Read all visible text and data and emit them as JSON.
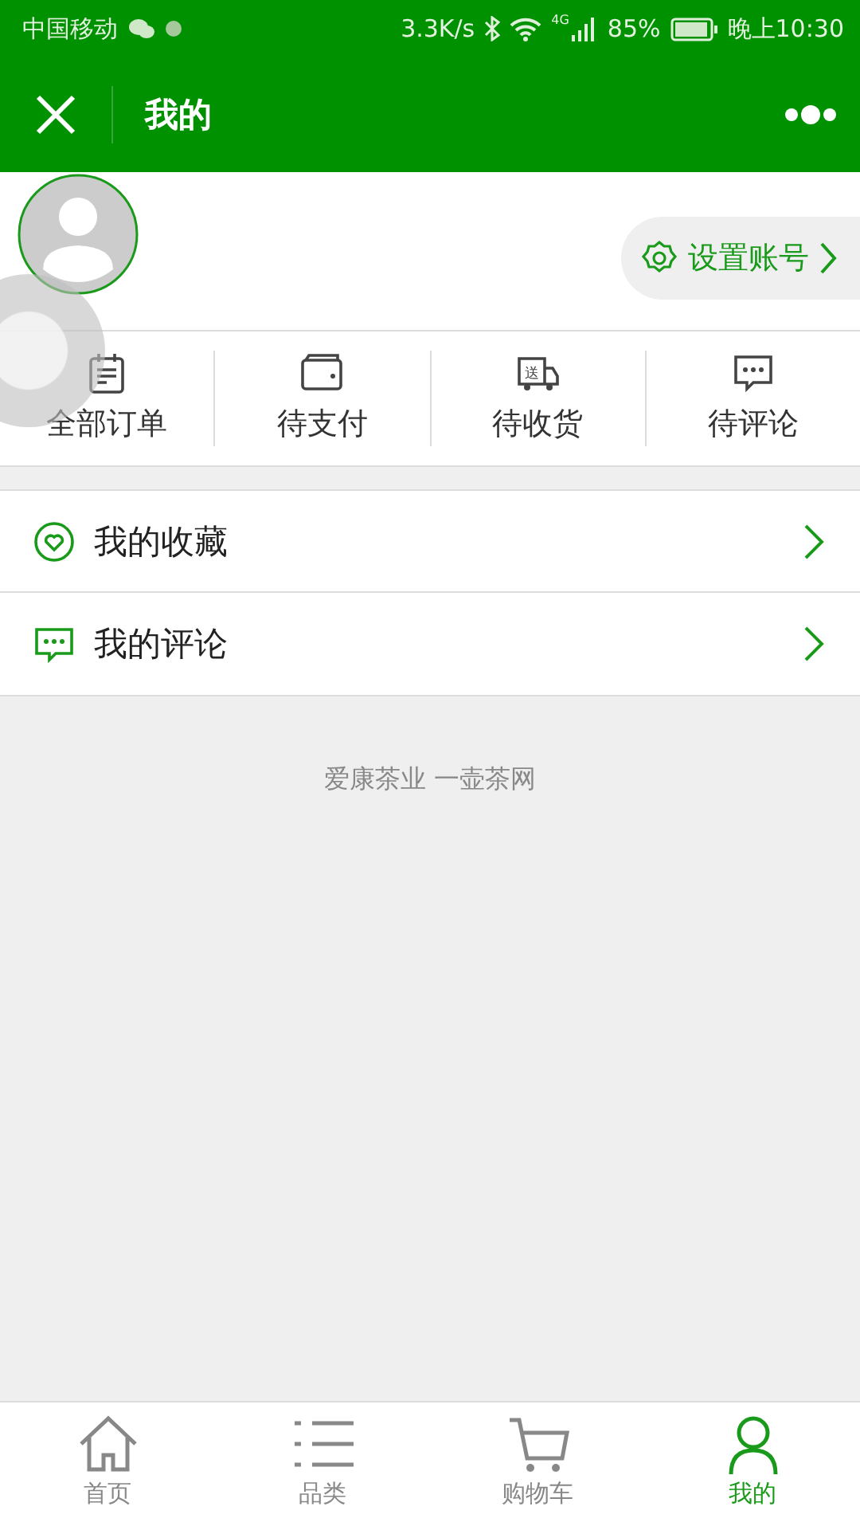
{
  "status_bar": {
    "carrier": "中国移动",
    "speed": "3.3K/s",
    "network": "4G",
    "battery": "85%",
    "time": "晚上10:30"
  },
  "title_bar": {
    "title": "我的"
  },
  "profile": {
    "settings_button": "设置账号"
  },
  "orders": [
    {
      "kind": "list",
      "label": "全部订单"
    },
    {
      "kind": "wallet",
      "label": "待支付"
    },
    {
      "kind": "truck",
      "label": "待收货",
      "icon_text": "送"
    },
    {
      "kind": "comment",
      "label": "待评论"
    }
  ],
  "menu": [
    {
      "kind": "heart",
      "label": "我的收藏"
    },
    {
      "kind": "comment",
      "label": "我的评论"
    }
  ],
  "footer_text": "爱康茶业 一壶茶网",
  "tab_bar": [
    {
      "kind": "home",
      "label": "首页",
      "selected": false
    },
    {
      "kind": "list",
      "label": "品类",
      "selected": false
    },
    {
      "kind": "cart",
      "label": "购物车",
      "selected": false
    },
    {
      "kind": "user",
      "label": "我的",
      "selected": true
    }
  ]
}
